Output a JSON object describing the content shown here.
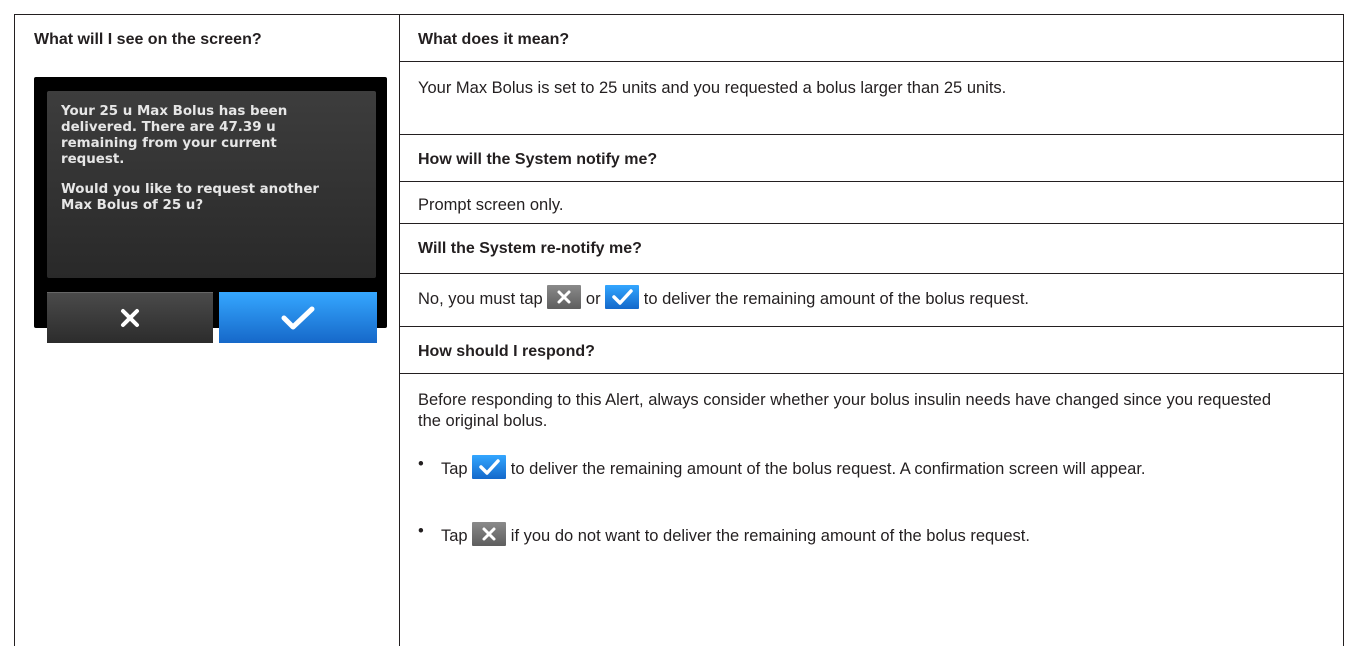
{
  "left": {
    "heading": "What will I see on the screen?",
    "device": {
      "message_line1": "Your 25 u Max Bolus has been\ndelivered. There are 47.39 u\nremaining from your current\nrequest.",
      "message_line2": "Would you like to request another\nMax Bolus of 25 u?",
      "cancel_icon": "x-icon",
      "confirm_icon": "check-icon",
      "colors": {
        "confirm": "#1e7fe0",
        "cancel": "#3a3a3a"
      }
    }
  },
  "sections": {
    "meaning": {
      "heading": "What does it mean?",
      "text": "Your Max Bolus is set to 25 units and you requested a bolus larger than 25 units."
    },
    "notify": {
      "heading": "How will the System notify me?",
      "text": "Prompt screen only."
    },
    "renotify": {
      "heading": "Will the System re-notify me?",
      "text_a": "No, you must tap",
      "text_b": "or",
      "text_c": "to deliver the remaining amount of the bolus request."
    },
    "respond": {
      "heading": "How should I respond?",
      "intro": "Before responding to this Alert, always consider whether your bolus insulin needs have changed since you requested the original bolus.",
      "bullet1_a": "Tap",
      "bullet1_b": "to deliver the remaining amount of the bolus request. A confirmation screen will appear.",
      "bullet2_a": "Tap",
      "bullet2_b": "if you do not want to deliver the remaining amount of the bolus request."
    }
  }
}
